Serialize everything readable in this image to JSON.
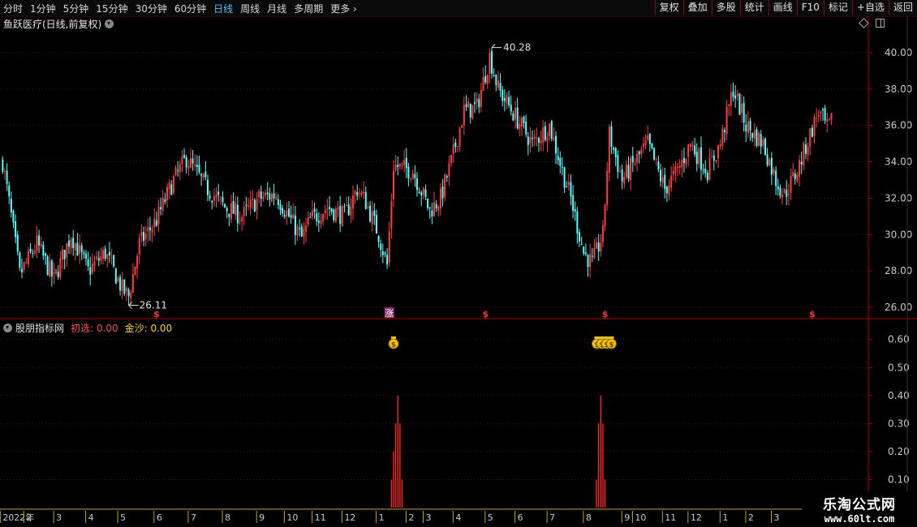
{
  "toolbar": {
    "periods": [
      {
        "label": "分时",
        "active": false
      },
      {
        "label": "1分钟",
        "active": false
      },
      {
        "label": "5分钟",
        "active": false
      },
      {
        "label": "15分钟",
        "active": false
      },
      {
        "label": "30分钟",
        "active": false
      },
      {
        "label": "60分钟",
        "active": false
      },
      {
        "label": "日线",
        "active": true
      },
      {
        "label": "周线",
        "active": false
      },
      {
        "label": "月线",
        "active": false
      },
      {
        "label": "多周期",
        "active": false
      },
      {
        "label": "更多",
        "active": false
      }
    ],
    "buttons": [
      "复权",
      "叠加",
      "多股",
      "统计",
      "画线",
      "F10",
      "标记",
      "+自选",
      "返回"
    ]
  },
  "stock_title": "鱼跃医疗(日线,前复权)",
  "indicator": {
    "name": "股朋指标网",
    "label1": "初选: 0.00",
    "label2": "金沙: 0.00"
  },
  "watermark": {
    "title": "乐淘公式网",
    "url": "www.60lt.com"
  },
  "colors": {
    "up": "#ff3c3c",
    "down": "#54ffff",
    "axis": "#b40000",
    "grid": "#7a0000",
    "text": "#c8c8c8",
    "indicator": "#ff2020"
  },
  "chart_data": [
    {
      "type": "candlestick",
      "title": "鱼跃医疗(日线,前复权)",
      "ylim": [
        25.6,
        41.2
      ],
      "yticks": [
        "40.00",
        "38.00",
        "36.00",
        "34.00",
        "32.00",
        "30.00",
        "28.00",
        "26.00"
      ],
      "ytick_values": [
        40,
        38,
        36,
        34,
        32,
        30,
        28,
        26
      ],
      "x_months": [
        {
          "label": "2022年",
          "i": 0
        },
        {
          "label": "2",
          "i": 11
        },
        {
          "label": "3",
          "i": 25
        },
        {
          "label": "4",
          "i": 40
        },
        {
          "label": "5",
          "i": 55
        },
        {
          "label": "6",
          "i": 72
        },
        {
          "label": "7",
          "i": 88
        },
        {
          "label": "8",
          "i": 104
        },
        {
          "label": "9",
          "i": 120
        },
        {
          "label": "10",
          "i": 133
        },
        {
          "label": "11",
          "i": 146
        },
        {
          "label": "12",
          "i": 160
        },
        {
          "label": "1",
          "i": 176
        },
        {
          "label": "2",
          "i": 190
        },
        {
          "label": "3",
          "i": 198
        },
        {
          "label": "4",
          "i": 212
        },
        {
          "label": "5",
          "i": 227
        },
        {
          "label": "6",
          "i": 241
        },
        {
          "label": "7",
          "i": 256
        },
        {
          "label": "8",
          "i": 273
        },
        {
          "label": "9",
          "i": 291
        },
        {
          "label": "10",
          "i": 296
        },
        {
          "label": "11",
          "i": 310
        },
        {
          "label": "12",
          "i": 322
        },
        {
          "label": "1",
          "i": 337
        },
        {
          "label": "2",
          "i": 349
        },
        {
          "label": "3",
          "i": 361
        }
      ],
      "n_bars": 405,
      "trend_points": [
        [
          0,
          34
        ],
        [
          4,
          31
        ],
        [
          8,
          27.8
        ],
        [
          16,
          29.5
        ],
        [
          24,
          27.5
        ],
        [
          32,
          30
        ],
        [
          40,
          28
        ],
        [
          48,
          29
        ],
        [
          56,
          27
        ],
        [
          59,
          26.6
        ],
        [
          64,
          29.5
        ],
        [
          72,
          30.8
        ],
        [
          80,
          33
        ],
        [
          86,
          34.2
        ],
        [
          96,
          32.5
        ],
        [
          104,
          31.5
        ],
        [
          112,
          31
        ],
        [
          120,
          32
        ],
        [
          128,
          32.2
        ],
        [
          136,
          30.6
        ],
        [
          140,
          29.8
        ],
        [
          144,
          30.8
        ],
        [
          152,
          31.5
        ],
        [
          160,
          31
        ],
        [
          166,
          32.5
        ],
        [
          170,
          31.8
        ],
        [
          176,
          30
        ],
        [
          180,
          28.3
        ],
        [
          183,
          33.8
        ],
        [
          192,
          33.5
        ],
        [
          200,
          31.3
        ],
        [
          205,
          32
        ],
        [
          210,
          34
        ],
        [
          216,
          36.8
        ],
        [
          222,
          37
        ],
        [
          228,
          39.8
        ],
        [
          232,
          38
        ],
        [
          240,
          36.5
        ],
        [
          248,
          35
        ],
        [
          256,
          36
        ],
        [
          262,
          33.5
        ],
        [
          266,
          32
        ],
        [
          272,
          29
        ],
        [
          276,
          28.4
        ],
        [
          281,
          30
        ],
        [
          284,
          35.5
        ],
        [
          290,
          33
        ],
        [
          296,
          34
        ],
        [
          302,
          35
        ],
        [
          310,
          32.5
        ],
        [
          316,
          33.5
        ],
        [
          322,
          35
        ],
        [
          330,
          33.5
        ],
        [
          336,
          35
        ],
        [
          342,
          38
        ],
        [
          348,
          36
        ],
        [
          356,
          35
        ],
        [
          362,
          33
        ],
        [
          366,
          32.2
        ],
        [
          372,
          33.5
        ],
        [
          378,
          35.5
        ],
        [
          382,
          36.8
        ],
        [
          386,
          35.8
        ],
        [
          388,
          36.2
        ]
      ],
      "high": {
        "value": "40.28",
        "i": 229
      },
      "low": {
        "value": "26.11",
        "i": 59
      },
      "price_markers": [
        {
          "i": 72,
          "label": "$"
        },
        {
          "i": 181,
          "label": "涨"
        },
        {
          "i": 226,
          "label": "$"
        },
        {
          "i": 282,
          "label": "$"
        },
        {
          "i": 379,
          "label": "$"
        }
      ]
    },
    {
      "type": "bar",
      "title": "股朋指标网",
      "ylim": [
        0,
        0.66
      ],
      "yticks": [
        "0.60",
        "0.50",
        "0.40",
        "0.30",
        "0.20",
        "0.10"
      ],
      "ytick_values": [
        0.6,
        0.5,
        0.4,
        0.3,
        0.2,
        0.1
      ],
      "spikes": [
        {
          "i": 182,
          "values": [
            0.1,
            0.2,
            0.3,
            0.4,
            0.3,
            0.1
          ]
        },
        {
          "i": 278,
          "values": [
            0.1,
            0.3,
            0.4,
            0.3,
            0.1
          ]
        }
      ],
      "markers": [
        {
          "i": 183,
          "count": 1
        },
        {
          "i": 285,
          "count": 4
        }
      ]
    }
  ]
}
